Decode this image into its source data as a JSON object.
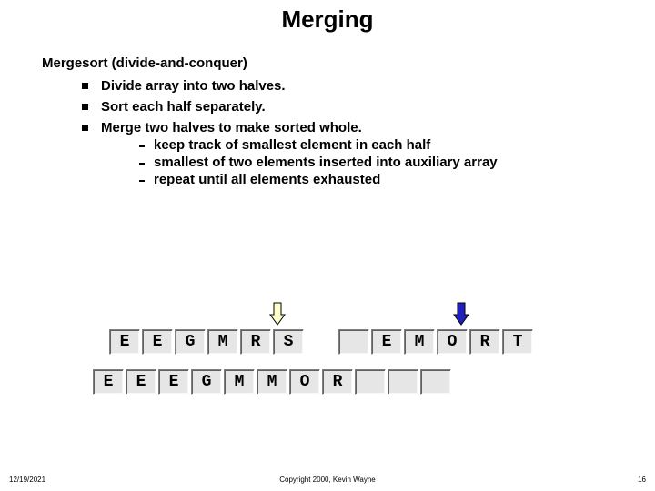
{
  "title": "Merging",
  "subtitle": "Mergesort  (divide-and-conquer)",
  "bullets": {
    "b1": "Divide array into two halves.",
    "b2": "Sort each half separately.",
    "b3": "Merge two halves to make sorted whole.",
    "s1": "keep track of smallest element in each half",
    "s2": "smallest of two elements inserted into auxiliary array",
    "s3": "repeat until all elements exhausted"
  },
  "row1": [
    "E",
    "E",
    "G",
    "M",
    "R",
    "S",
    "",
    "E",
    "M",
    "O",
    "R",
    "T"
  ],
  "row2": [
    "E",
    "E",
    "E",
    "G",
    "M",
    "M",
    "O",
    "R",
    "",
    "",
    ""
  ],
  "footer": {
    "left": "12/19/2021",
    "center": "Copyright 2000, Kevin Wayne",
    "right": "16"
  }
}
